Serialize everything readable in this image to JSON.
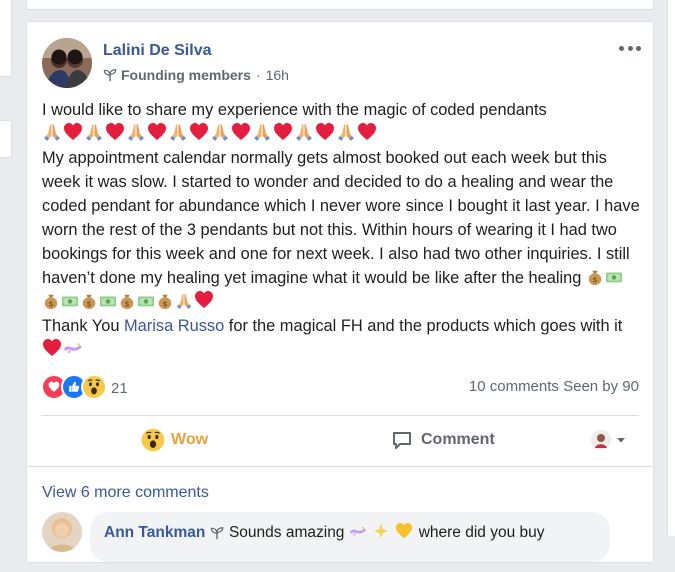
{
  "post": {
    "author": "Lalini De Silva",
    "group": "Founding members",
    "separator": "·",
    "time": "16h",
    "line1": "I would like to share my experience with the magic of coded pendants",
    "body": "My appointment calendar normally gets almost booked out each week but this week it was slow. I started to wonder and decided to do a healing and wear the coded pendant for abundance which I never wore since I bought it last year. I have worn the rest of the 3 pendants but not this. Within hours of wearing it I had two bookings for this week and one for next week. I also had two other inquiries. I still haven’t done my healing yet imagine what it would be like after the healing",
    "thanks_pre": "Thank You ",
    "mention": "Marisa Russo",
    "thanks_post": " for the magical FH and the products which goes with it"
  },
  "stats": {
    "reaction_count": "21",
    "comments": "10 comments",
    "seen": "Seen by 90"
  },
  "actions": {
    "wow": "Wow",
    "comment": "Comment"
  },
  "comments": {
    "view_more": "View 6 more comments",
    "first_author": "Ann Tankman",
    "first_text_a": "Sounds amazing",
    "first_text_b": "where did you buy"
  },
  "colors": {
    "link": "#385898",
    "wow": "#e9a13b",
    "heart": "#e41e3f",
    "like": "#1877f2",
    "background": "#e9ebee"
  },
  "icons": [
    "sprout-icon",
    "more-icon",
    "pray-icon",
    "heart-icon",
    "money-bag-icon",
    "money-bill-icon",
    "ribbon-icon",
    "love-reaction-icon",
    "like-reaction-icon",
    "wow-reaction-icon",
    "comment-icon",
    "sparkle-icon",
    "yellow-heart-icon"
  ]
}
